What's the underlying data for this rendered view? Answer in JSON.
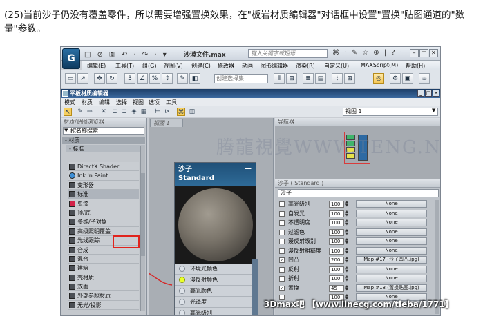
{
  "caption": "(25)当前沙子仍没有覆盖零件，所以需要增强置换效果，在\"板岩材质编辑器\"对话框中设置\"置换\"贴图通道的\"数量\"参数。",
  "app": {
    "logo": "G",
    "quick_access": "□ ⊘ 🖫 ↶ · ↷ · ▾",
    "title": "沙漠文件.max",
    "search_placeholder": "键入关键字或短语",
    "title_icons": "⌘ · ✎ ☆ ⊕ | ? ·",
    "menu": [
      "编辑(E)",
      "工具(T)",
      "组(G)",
      "视图(V)",
      "创建(C)",
      "修改器",
      "动画",
      "图形编辑器",
      "渲染(R)",
      "自定义(U)",
      "MAXScript(M)",
      "帮助(H)"
    ],
    "selection_set_placeholder": "创建选择集"
  },
  "material_editor": {
    "title": "平板材质编辑器",
    "menu": [
      "模式",
      "材质",
      "编辑",
      "选择",
      "视图",
      "选项",
      "工具"
    ],
    "view_dropdown": "视图 1",
    "browser": {
      "header": "材质/贴图浏览器",
      "search_value": "按名称搜索...",
      "group": "- 材质",
      "sub_group": "- 标准",
      "items": [
        {
          "label": "DirectX Shader",
          "swatch": "dark"
        },
        {
          "label": "Ink 'n Paint",
          "swatch": "blue"
        },
        {
          "label": "变形器",
          "swatch": "dark"
        },
        {
          "label": "标准",
          "swatch": "dark"
        },
        {
          "label": "虫漆",
          "swatch": "red"
        },
        {
          "label": "顶/底",
          "swatch": "dark"
        },
        {
          "label": "多维/子对象",
          "swatch": "dark"
        },
        {
          "label": "高级照明覆盖",
          "swatch": "dark"
        },
        {
          "label": "光线跟踪",
          "swatch": "dark"
        },
        {
          "label": "合成",
          "swatch": "dark"
        },
        {
          "label": "混合",
          "swatch": "dark"
        },
        {
          "label": "建筑",
          "swatch": "dark"
        },
        {
          "label": "壳材质",
          "swatch": "dark"
        },
        {
          "label": "双面",
          "swatch": "dark"
        },
        {
          "label": "外部参照材质",
          "swatch": "dark"
        },
        {
          "label": "无光/投影",
          "swatch": "dark"
        }
      ]
    },
    "view": {
      "tab": "视图 1",
      "node": {
        "name": "沙子",
        "type": "Standard",
        "slots": [
          "环境光颜色",
          "漫反射颜色",
          "高光颜色",
          "光泽度",
          "高光级别"
        ]
      }
    },
    "navigator": {
      "header": "导航器"
    },
    "params": {
      "header": "沙子 ( Standard )",
      "name": "沙子",
      "rows": [
        {
          "label": "高光级别",
          "checked": false,
          "amount": "100",
          "map": "None"
        },
        {
          "label": "自发光",
          "checked": false,
          "amount": "100",
          "map": "None"
        },
        {
          "label": "不透明度",
          "checked": false,
          "amount": "100",
          "map": "None"
        },
        {
          "label": "过滤色",
          "checked": false,
          "amount": "100",
          "map": "None"
        },
        {
          "label": "漫反射级别",
          "checked": false,
          "amount": "100",
          "map": "None"
        },
        {
          "label": "漫反射粗糙度",
          "checked": false,
          "amount": "100",
          "map": "None"
        },
        {
          "label": "凹凸",
          "checked": true,
          "amount": "200",
          "map": "Map #17 (沙子凹凸.jpg)"
        },
        {
          "label": "反射",
          "checked": false,
          "amount": "100",
          "map": "None"
        },
        {
          "label": "折射",
          "checked": false,
          "amount": "100",
          "map": "None"
        },
        {
          "label": "置换",
          "checked": true,
          "amount": "45",
          "map": "Map #18 (置换贴图.jpg)"
        },
        {
          "label": "",
          "checked": false,
          "amount": "100",
          "map": "None"
        }
      ]
    }
  },
  "watermark": "腾龍視覺WWW.TENG.NET",
  "footer_watermark": "3Dmax吧 【www.linecg.com/tieba/1771】"
}
